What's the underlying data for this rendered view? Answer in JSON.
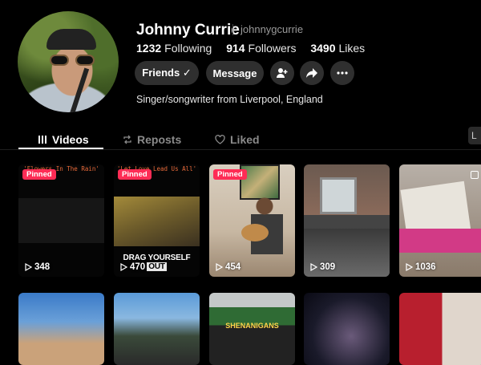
{
  "profile": {
    "name": "Johnny Currie",
    "handle": "johnnygcurrie",
    "stats": [
      {
        "value": "1232",
        "label": "Following"
      },
      {
        "value": "914",
        "label": "Followers"
      },
      {
        "value": "3490",
        "label": "Likes"
      }
    ],
    "friends_label": "Friends ✓",
    "message_label": "Message",
    "bio": "Singer/songwriter from Liverpool, England"
  },
  "tabs": [
    {
      "label": "Videos",
      "icon": "grid-icon",
      "active": true
    },
    {
      "label": "Reposts",
      "icon": "repost-icon",
      "active": false
    },
    {
      "label": "Liked",
      "icon": "liked-icon",
      "active": false
    }
  ],
  "sort_chip": "L",
  "videos": [
    {
      "pinned": "Pinned",
      "caption": "'Flowers In The Rain'",
      "views": "348"
    },
    {
      "pinned": "Pinned",
      "caption": "'Let Love Lead Us All'",
      "overlay_text": "DRAG YOURSELF",
      "overlay_highlight": "OUT",
      "views": "470"
    },
    {
      "pinned": "Pinned",
      "views": "454"
    },
    {
      "views": "309"
    },
    {
      "views": "1036"
    }
  ],
  "row2_sign": "SHENANIGANS",
  "colors": {
    "accent": "#fe2c55",
    "button_bg": "#2f2f2f",
    "background": "#000000"
  }
}
